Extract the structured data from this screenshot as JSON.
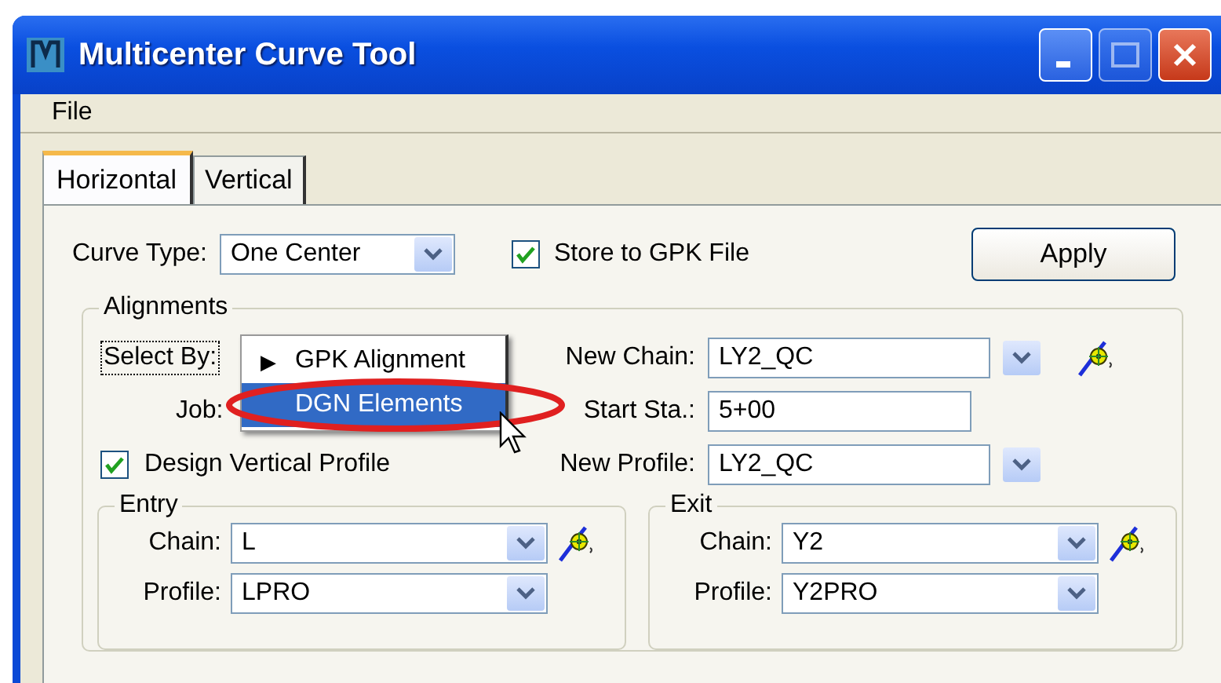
{
  "window": {
    "title": "Multicenter Curve Tool"
  },
  "menu": [
    "File"
  ],
  "tabs": [
    {
      "label": "Horizontal",
      "selected": true
    },
    {
      "label": "Vertical",
      "selected": false
    }
  ],
  "curve_type": {
    "label": "Curve Type:",
    "value": "One Center"
  },
  "store_to_gpk": {
    "label": "Store to GPK File",
    "checked": true
  },
  "apply_button": "Apply",
  "alignments": {
    "title": "Alignments",
    "select_by": {
      "label": "Select By:",
      "menu": [
        {
          "marker": "▶",
          "label": "GPK Alignment",
          "selected": false
        },
        {
          "label": "DGN Elements",
          "selected": true
        }
      ]
    },
    "job": {
      "label": "Job:"
    },
    "design_vertical_profile": {
      "label": "Design Vertical Profile",
      "checked": true
    },
    "new_chain": {
      "label": "New Chain:",
      "value": "LY2_QC"
    },
    "start_sta": {
      "label": "Start Sta.:",
      "value": "5+00"
    },
    "new_profile": {
      "label": "New Profile:",
      "value": "LY2_QC"
    }
  },
  "groups": [
    {
      "title": "Entry",
      "chain": {
        "label": "Chain:",
        "value": "L"
      },
      "profile": {
        "label": "Profile:",
        "value": "LPRO"
      }
    },
    {
      "title": "Exit",
      "chain": {
        "label": "Chain:",
        "value": "Y2"
      },
      "profile": {
        "label": "Profile:",
        "value": "Y2PRO"
      }
    }
  ]
}
